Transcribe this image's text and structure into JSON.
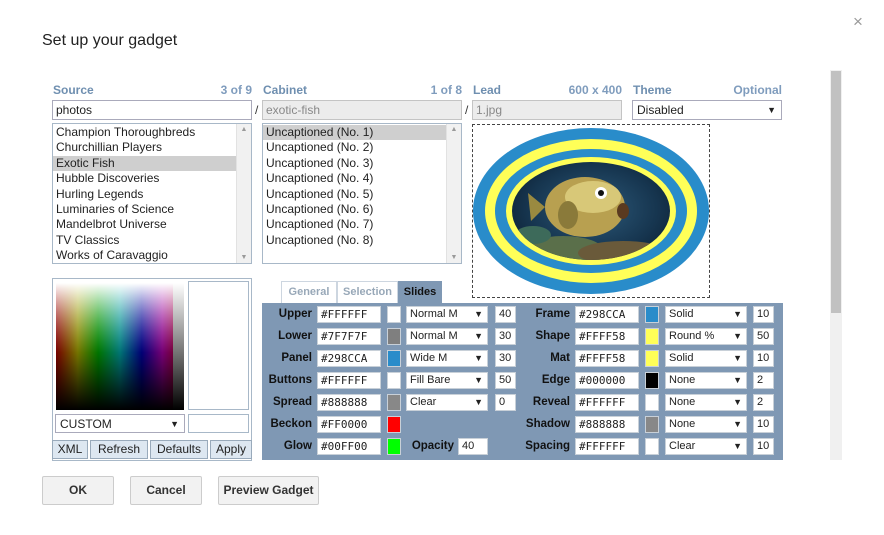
{
  "dialog": {
    "title": "Set up your gadget",
    "close": "×"
  },
  "source": {
    "label": "Source",
    "count": "3 of 9",
    "value": "photos",
    "items": [
      "Champion Thoroughbreds",
      "Churchillian Players",
      "Exotic Fish",
      "Hubble Discoveries",
      "Hurling Legends",
      "Luminaries of Science",
      "Mandelbrot Universe",
      "TV Classics",
      "Works of Caravaggio"
    ],
    "selected_index": 2
  },
  "cabinet": {
    "label": "Cabinet",
    "count": "1 of 8",
    "value": "exotic-fish",
    "items": [
      "Uncaptioned (No. 1)",
      "Uncaptioned (No. 2)",
      "Uncaptioned (No. 3)",
      "Uncaptioned (No. 4)",
      "Uncaptioned (No. 5)",
      "Uncaptioned (No. 6)",
      "Uncaptioned (No. 7)",
      "Uncaptioned (No. 8)"
    ],
    "selected_index": 0
  },
  "lead": {
    "label": "Lead",
    "size": "600 x 400",
    "value": "1.jpg"
  },
  "theme": {
    "label": "Theme",
    "note": "Optional",
    "value": "Disabled"
  },
  "separator": "/",
  "picker": {
    "mode": "CUSTOM",
    "buttons": [
      "XML",
      "Refresh",
      "Defaults",
      "Apply"
    ]
  },
  "tabs": [
    "General",
    "Selection",
    "Slides"
  ],
  "active_tab": "Slides",
  "left_rows": [
    {
      "label": "Upper",
      "hex": "#FFFFFF",
      "color": "#FFFFFF",
      "dd": "Normal M",
      "num": "40"
    },
    {
      "label": "Lower",
      "hex": "#7F7F7F",
      "color": "#7F7F7F",
      "dd": "Normal M",
      "num": "30"
    },
    {
      "label": "Panel",
      "hex": "#298CCA",
      "color": "#298CCA",
      "dd": "Wide M",
      "num": "30"
    },
    {
      "label": "Buttons",
      "hex": "#FFFFFF",
      "color": "#FFFFFF",
      "dd": "Fill Bare",
      "num": "50"
    },
    {
      "label": "Spread",
      "hex": "#888888",
      "color": "#888888",
      "dd": "Clear",
      "num": "0"
    },
    {
      "label": "Beckon",
      "hex": "#FF0000",
      "color": "#FF0000"
    },
    {
      "label": "Glow",
      "hex": "#00FF00",
      "color": "#00FF00",
      "extra_label": "Opacity",
      "extra_num": "40"
    }
  ],
  "right_rows": [
    {
      "label": "Frame",
      "hex": "#298CCA",
      "color": "#298CCA",
      "dd": "Solid",
      "num": "10"
    },
    {
      "label": "Shape",
      "hex": "#FFFF58",
      "color": "#FFFF58",
      "dd": "Round %",
      "num": "50"
    },
    {
      "label": "Mat",
      "hex": "#FFFF58",
      "color": "#FFFF58",
      "dd": "Solid",
      "num": "10"
    },
    {
      "label": "Edge",
      "hex": "#000000",
      "color": "#000000",
      "dd": "None",
      "num": "2"
    },
    {
      "label": "Reveal",
      "hex": "#FFFFFF",
      "color": "#FFFFFF",
      "dd": "None",
      "num": "2"
    },
    {
      "label": "Shadow",
      "hex": "#888888",
      "color": "#888888",
      "dd": "None",
      "num": "10"
    },
    {
      "label": "Spacing",
      "hex": "#FFFFFF",
      "color": "#FFFFFF",
      "dd": "Clear",
      "num": "10"
    }
  ],
  "footer": {
    "ok": "OK",
    "cancel": "Cancel",
    "preview": "Preview Gadget"
  },
  "icons": {
    "dropdown": "▼",
    "scroll_up": "▲",
    "scroll_down": "▼"
  },
  "colors": {
    "accent": "#7f98b4",
    "header": "#6f8fb0"
  }
}
